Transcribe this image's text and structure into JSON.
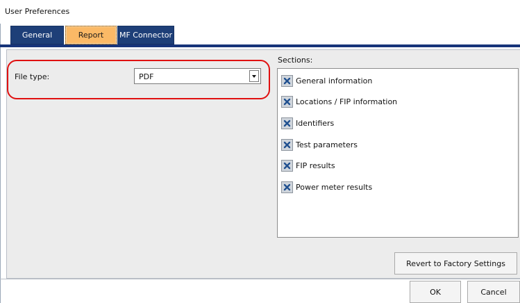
{
  "window": {
    "title": "User Preferences"
  },
  "tabs": [
    {
      "label": "General",
      "selected": false
    },
    {
      "label": "Report",
      "selected": true
    },
    {
      "label": "MF Connector",
      "selected": false
    }
  ],
  "report": {
    "file_type_label": "File type:",
    "file_type_value": "PDF",
    "sections_label": "Sections:",
    "sections": [
      {
        "label": "General information",
        "checked": true
      },
      {
        "label": "Locations / FIP information",
        "checked": true
      },
      {
        "label": "Identifiers",
        "checked": true
      },
      {
        "label": "Test parameters",
        "checked": true
      },
      {
        "label": "FIP results",
        "checked": true
      },
      {
        "label": "Power meter results",
        "checked": true
      }
    ],
    "revert_label": "Revert to Factory Settings"
  },
  "buttons": {
    "ok_label": "OK",
    "cancel_label": "Cancel"
  },
  "colors": {
    "tab_dark": "#1e3f78",
    "tab_selected": "#fbb966",
    "tab_strip": "#17347a",
    "highlight": "#e01010",
    "check_x": "#1f4f8f"
  }
}
